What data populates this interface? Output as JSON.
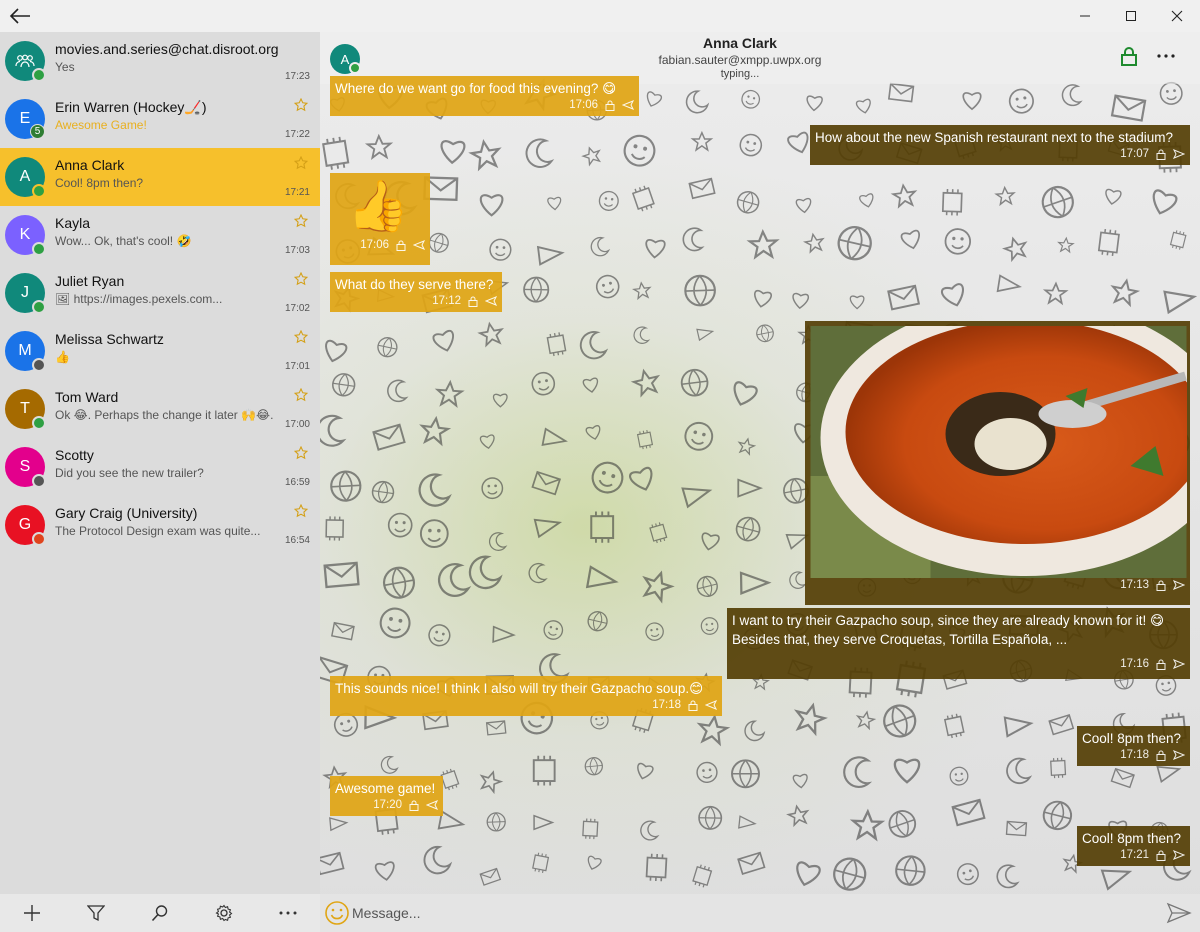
{
  "colors": {
    "accent": "#f6c02c",
    "incoming_bubble": "#e0a514",
    "outgoing_bubble": "#543e04",
    "online": "#2ea043",
    "offline": "#555555",
    "dnd": "#e0441e"
  },
  "titlebar": {
    "back_icon": "back-arrow-icon",
    "controls": [
      "minimize-icon",
      "maximize-icon",
      "close-icon"
    ]
  },
  "chats": [
    {
      "initial": "",
      "icon": "group-icon",
      "avatar_color": "#10897b",
      "name": "movies.and.series@chat.disroot.org",
      "preview": "Yes",
      "time": "17:23",
      "starred": false,
      "presence": "#2ea043",
      "unread": "",
      "highlight": false,
      "active": false
    },
    {
      "initial": "E",
      "avatar_color": "#1a73e8",
      "name": "Erin Warren (Hockey🏒)",
      "preview": "Awesome Game!",
      "time": "17:22",
      "starred": true,
      "presence": "#2ea043",
      "unread": "5",
      "highlight": true,
      "active": false
    },
    {
      "initial": "A",
      "avatar_color": "#10897b",
      "name": "Anna Clark",
      "preview": "Cool! 8pm then?",
      "time": "17:21",
      "starred": true,
      "presence": "#2ea043",
      "unread": "",
      "highlight": false,
      "active": true
    },
    {
      "initial": "K",
      "avatar_color": "#7b61ff",
      "name": "Kayla",
      "preview": "Wow... Ok, that's cool! 🤣",
      "time": "17:03",
      "starred": true,
      "presence": "#2ea043",
      "unread": "",
      "highlight": false,
      "active": false
    },
    {
      "initial": "J",
      "avatar_color": "#10897b",
      "name": "Juliet Ryan",
      "preview": "🖼 https://images.pexels.com...",
      "time": "17:02",
      "starred": true,
      "presence": "#2ea043",
      "unread": "",
      "highlight": false,
      "active": false
    },
    {
      "initial": "M",
      "avatar_color": "#1a73e8",
      "name": "Melissa Schwartz",
      "preview": "👍",
      "time": "17:01",
      "starred": true,
      "presence": "#555555",
      "unread": "",
      "highlight": false,
      "active": false
    },
    {
      "initial": "T",
      "avatar_color": "#a56a00",
      "name": "Tom Ward",
      "preview": "Ok 😂. Perhaps the change it later 🙌😂.",
      "time": "17:00",
      "starred": true,
      "presence": "#2ea043",
      "unread": "",
      "highlight": false,
      "active": false
    },
    {
      "initial": "S",
      "avatar_color": "#e3008c",
      "name": "Scotty",
      "preview": "Did you see the new trailer?",
      "time": "16:59",
      "starred": true,
      "presence": "#555555",
      "unread": "",
      "highlight": false,
      "active": false
    },
    {
      "initial": "G",
      "avatar_color": "#e81123",
      "name": "Gary Craig (University)",
      "preview": "The Protocol Design exam was quite...",
      "time": "16:54",
      "starred": true,
      "presence": "#e0441e",
      "unread": "",
      "highlight": false,
      "active": false
    }
  ],
  "bottom_bar": {
    "buttons": [
      "add-icon",
      "filter-icon",
      "search-icon",
      "settings-icon",
      "more-icon"
    ]
  },
  "header": {
    "avatar_initial": "A",
    "name": "Anna Clark",
    "jid": "fabian.sauter@xmpp.uwpx.org",
    "status": "typing..."
  },
  "messages": [
    {
      "dir": "in",
      "text": "Where do we want go for food this evening? 😋",
      "time": "17:06"
    },
    {
      "dir": "out",
      "text": "How about the new Spanish restaurant next to the stadium?",
      "time": "17:07"
    },
    {
      "dir": "in",
      "text": "👍",
      "time": "17:06",
      "big_emoji": true
    },
    {
      "dir": "in",
      "text": "What do they serve there?",
      "time": "17:12"
    },
    {
      "dir": "out",
      "image": "gazpacho-soup-image",
      "time": "17:13"
    },
    {
      "dir": "out",
      "text": "I want to try their Gazpacho soup, since they are already known for it! 😋",
      "text2": "Besides that, they serve Croquetas, Tortilla Española, ...",
      "time": "17:16"
    },
    {
      "dir": "in",
      "text": "This sounds nice! I think I also will try their Gazpacho soup.😊",
      "time": "17:18"
    },
    {
      "dir": "out",
      "text": "Cool! 8pm then?",
      "time": "17:18"
    },
    {
      "dir": "in",
      "text": "Awesome game!",
      "time": "17:20"
    },
    {
      "dir": "out",
      "text": "Cool! 8pm then?",
      "time": "17:21"
    }
  ],
  "composer": {
    "placeholder": "Message..."
  }
}
